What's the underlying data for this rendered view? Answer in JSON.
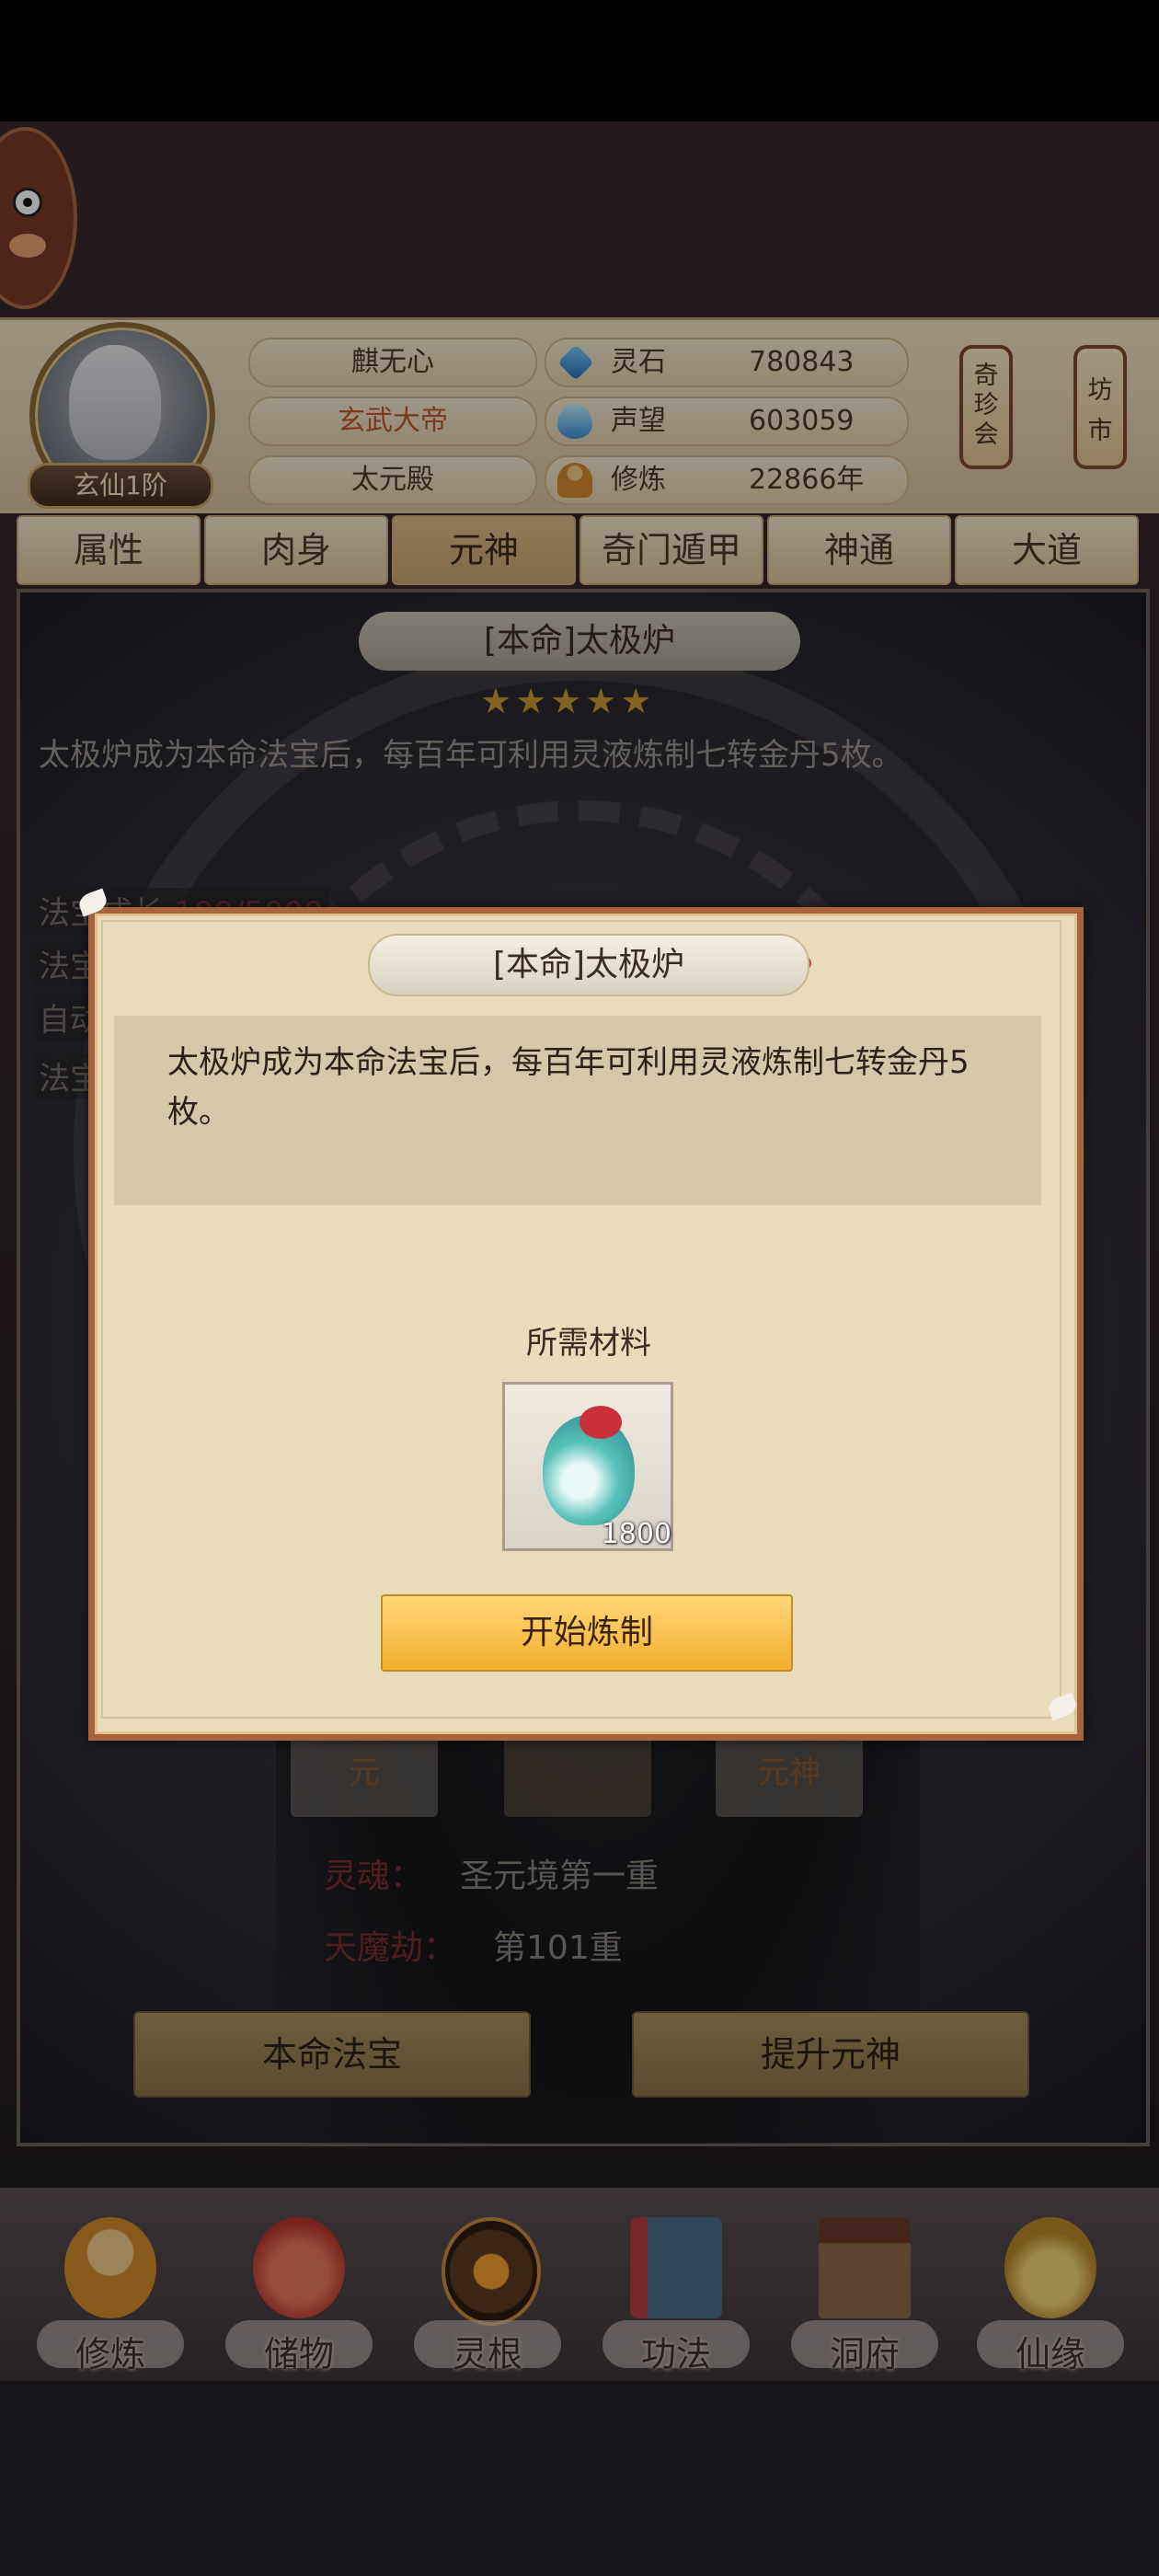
{
  "header": {
    "player_name": "麒无心",
    "title": "玄武大帝",
    "sect": "太元殿",
    "rank": "玄仙1阶",
    "resources": [
      {
        "icon": "spirit-stone-icon",
        "label": "灵石",
        "value": "780843"
      },
      {
        "icon": "prestige-icon",
        "label": "声望",
        "value": "603059"
      },
      {
        "icon": "cultivation-icon",
        "label": "修炼",
        "value": "22866年"
      }
    ],
    "side_buttons": [
      "奇珍会",
      "坊市"
    ]
  },
  "tabs": [
    {
      "label": "属性",
      "active": false
    },
    {
      "label": "肉身",
      "active": false
    },
    {
      "label": "元神",
      "active": true
    },
    {
      "label": "奇门遁甲",
      "active": false
    },
    {
      "label": "神通",
      "active": false
    },
    {
      "label": "大道",
      "active": false
    }
  ],
  "background_panel": {
    "title": "[本命]太极炉",
    "stars": "★★★★★",
    "description": "太极炉成为本命法宝后，每百年可利用灵液炼制七转金丹5枚。",
    "rows": [
      "法宝成长",
      "法宝",
      "自动",
      "法宝"
    ],
    "row_value": "100/5000",
    "small_buttons": [
      "元",
      "元神"
    ],
    "info": [
      {
        "key": "灵魂：",
        "value": "圣元境第一重"
      },
      {
        "key": "天魔劫：",
        "value": "第101重"
      }
    ],
    "actions": [
      "本命法宝",
      "提升元神"
    ]
  },
  "modal": {
    "title": "[本命]太极炉",
    "description": "太极炉成为本命法宝后，每百年可利用灵液炼制七转金丹5枚。",
    "required_label": "所需材料",
    "item": {
      "icon": "spirit-liquid-gourd-icon",
      "count": "1800"
    },
    "button_label": "开始炼制"
  },
  "bottom_nav": [
    {
      "icon": "cultivate-icon",
      "label": "修炼"
    },
    {
      "icon": "storage-bag-icon",
      "label": "储物"
    },
    {
      "icon": "spirit-root-icon",
      "label": "灵根"
    },
    {
      "icon": "technique-book-icon",
      "label": "功法"
    },
    {
      "icon": "cave-house-icon",
      "label": "洞府"
    },
    {
      "icon": "fortune-gourd-icon",
      "label": "仙缘"
    }
  ],
  "colors": {
    "accent_gold": "#f4ae2e",
    "modal_border": "#a7643a",
    "title_red": "#b44c3a"
  }
}
